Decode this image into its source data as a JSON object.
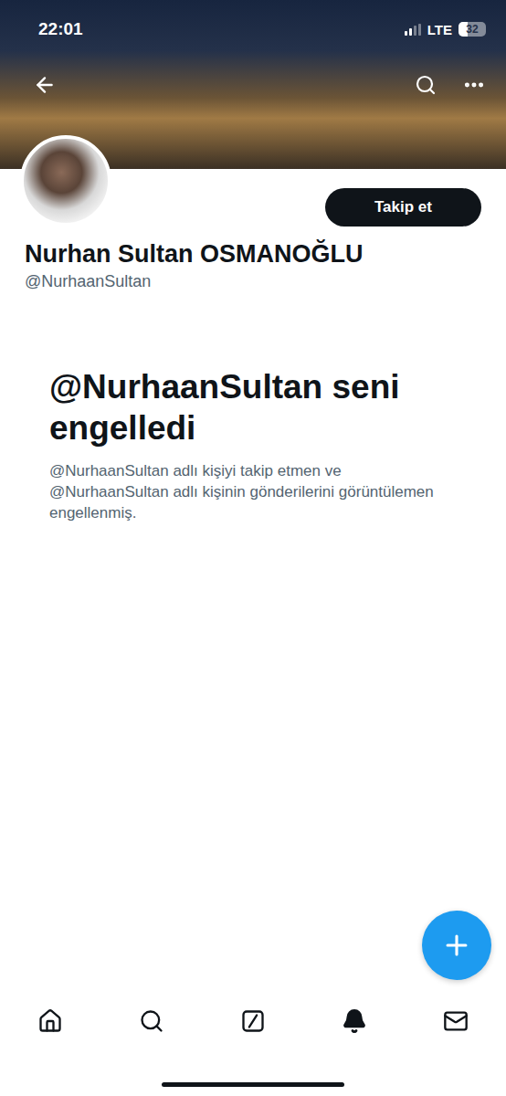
{
  "status_bar": {
    "time": "22:01",
    "network": "LTE",
    "battery": "32",
    "signal_level": 0.5,
    "battery_level": 0.32
  },
  "profile": {
    "name": "Nurhan Sultan OSMANOĞLU",
    "handle": "@NurhaanSultan",
    "follow_button": "Takip et"
  },
  "blocked": {
    "title": "@NurhaanSultan seni engelledi",
    "description": "@NurhaanSultan adlı kişiyi takip etmen ve @NurhaanSultan adlı kişinin gönderilerini görüntülemen engellenmiş."
  },
  "bottom_nav": [
    {
      "kind": "home",
      "selected": false
    },
    {
      "kind": "search",
      "selected": false
    },
    {
      "kind": "grok",
      "selected": false
    },
    {
      "kind": "notifications",
      "selected": true
    },
    {
      "kind": "messages",
      "selected": false
    }
  ]
}
